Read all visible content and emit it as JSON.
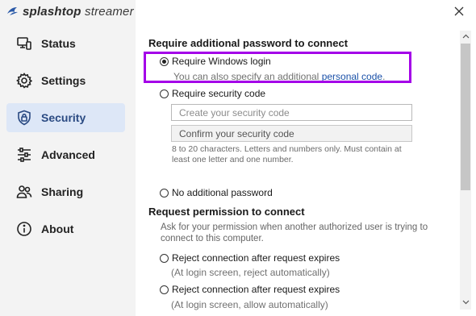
{
  "brand": {
    "bold": "splashtop",
    "rest": " streamer"
  },
  "sidebar": {
    "items": [
      {
        "label": "Status",
        "icon": "status-icon"
      },
      {
        "label": "Settings",
        "icon": "gear-icon"
      },
      {
        "label": "Security",
        "icon": "shield-lock-icon",
        "active": true
      },
      {
        "label": "Advanced",
        "icon": "sliders-icon"
      },
      {
        "label": "Sharing",
        "icon": "users-icon"
      },
      {
        "label": "About",
        "icon": "info-icon"
      }
    ]
  },
  "security": {
    "password_section_title": "Require additional password to connect",
    "windows_login": {
      "label": "Require Windows login",
      "hint_prefix": "You can also specify an additional ",
      "hint_link": "personal code",
      "hint_suffix": ".",
      "selected": true
    },
    "security_code": {
      "label": "Require security code",
      "create_placeholder": "Create your security code",
      "confirm_placeholder": "Confirm your security code",
      "rules": "8 to 20 characters. Letters and numbers only. Must contain at least one letter and one number."
    },
    "no_password": {
      "label": "No additional password"
    },
    "permission_section_title": "Request permission to connect",
    "permission_desc": "Ask for your permission when another authorized user is trying to connect to this computer.",
    "reject_option": {
      "label": "Reject connection after request expires",
      "sub": "(At login screen, reject automatically)"
    },
    "allow_option": {
      "label": "Reject connection after request expires",
      "sub": "(At login screen, allow automatically)"
    }
  },
  "colors": {
    "accent": "#2a4a82",
    "active_bg": "#dde7f7",
    "highlight": "#a400e8",
    "link": "#1a4fa8"
  }
}
